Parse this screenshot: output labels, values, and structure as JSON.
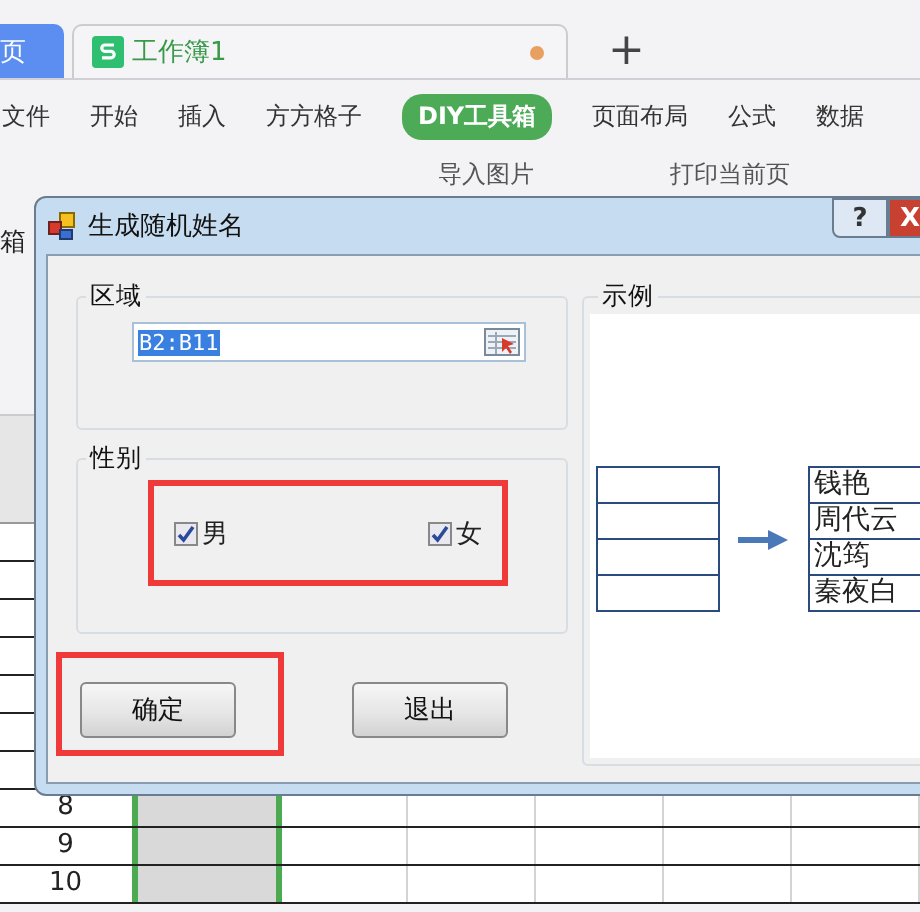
{
  "tabs": [
    {
      "label": "页",
      "kind": "home",
      "selected": false
    },
    {
      "label": "工作簿1",
      "kind": "sheet",
      "selected": true,
      "modified": true
    }
  ],
  "new_tab": "+",
  "menu": [
    {
      "label": "文件",
      "selected": false
    },
    {
      "label": "开始",
      "selected": false
    },
    {
      "label": "插入",
      "selected": false
    },
    {
      "label": "方方格子",
      "selected": false
    },
    {
      "label": "DIY工具箱",
      "selected": true
    },
    {
      "label": "页面布局",
      "selected": false
    },
    {
      "label": "公式",
      "selected": false
    },
    {
      "label": "数据",
      "selected": false
    }
  ],
  "toolbar": {
    "left_label": "箱",
    "items": [
      "导入图片",
      "打印当前页"
    ]
  },
  "sheet": {
    "rows": [
      {
        "number": "8"
      },
      {
        "number": "9"
      },
      {
        "number": "10"
      }
    ]
  },
  "dialog": {
    "title": "生成随机姓名",
    "help": "?",
    "close": "X",
    "range_group": {
      "label": "区域",
      "value": "B2:B11"
    },
    "gender_group": {
      "label": "性别",
      "options": [
        {
          "label": "男",
          "checked": true
        },
        {
          "label": "女",
          "checked": true
        }
      ]
    },
    "buttons": [
      {
        "label": "确定",
        "highlighted": true
      },
      {
        "label": "退出",
        "highlighted": false
      }
    ],
    "example": {
      "label": "示例",
      "names": [
        "钱艳",
        "周代云",
        "沈筠",
        "秦夜白"
      ]
    }
  }
}
